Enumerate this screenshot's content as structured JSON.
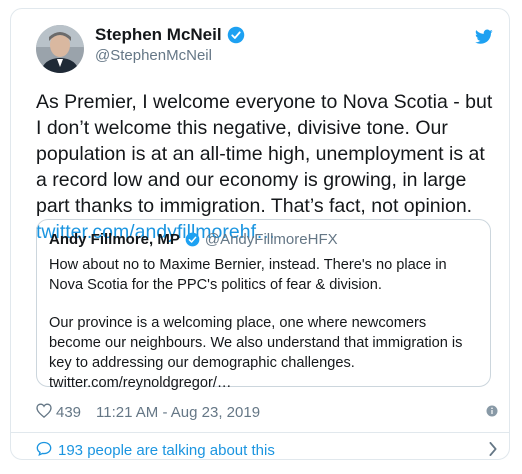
{
  "tweet": {
    "author": {
      "display_name": "Stephen McNeil",
      "handle": "@StephenMcNeil"
    },
    "text": "As Premier, I welcome everyone to Nova Scotia - but I don’t welcome this negative, divisive tone. Our population is at an all-time high, unemployment is at a record low and our economy is growing, in large part thanks to immigration. That’s fact, not opinion.",
    "link": "twitter.com/andyfillmorehf…",
    "likes": "439",
    "timestamp": "11:21 AM - Aug 23, 2019",
    "talking_about": "193 people are talking about this"
  },
  "quote": {
    "author": {
      "display_name": "Andy Fillmore, MP",
      "handle": "@AndyFillmoreHFX"
    },
    "paragraph1": "How about no to Maxime Bernier, instead. There's no place in Nova Scotia for the PPC's politics of fear & division.",
    "paragraph2": "Our province is a welcoming place, one where newcomers become our neighbours. We also understand that immigration is key to addressing our demographic challenges. twitter.com/reynoldgregor/…"
  },
  "colors": {
    "link": "#1b95e0",
    "verified": "#1da1f2",
    "secondary_text": "#657786",
    "border": "#e1e8ed"
  },
  "icons": [
    "verified-badge-icon",
    "twitter-bird-icon",
    "heart-icon",
    "info-icon",
    "speech-bubble-icon",
    "chevron-right-icon"
  ]
}
